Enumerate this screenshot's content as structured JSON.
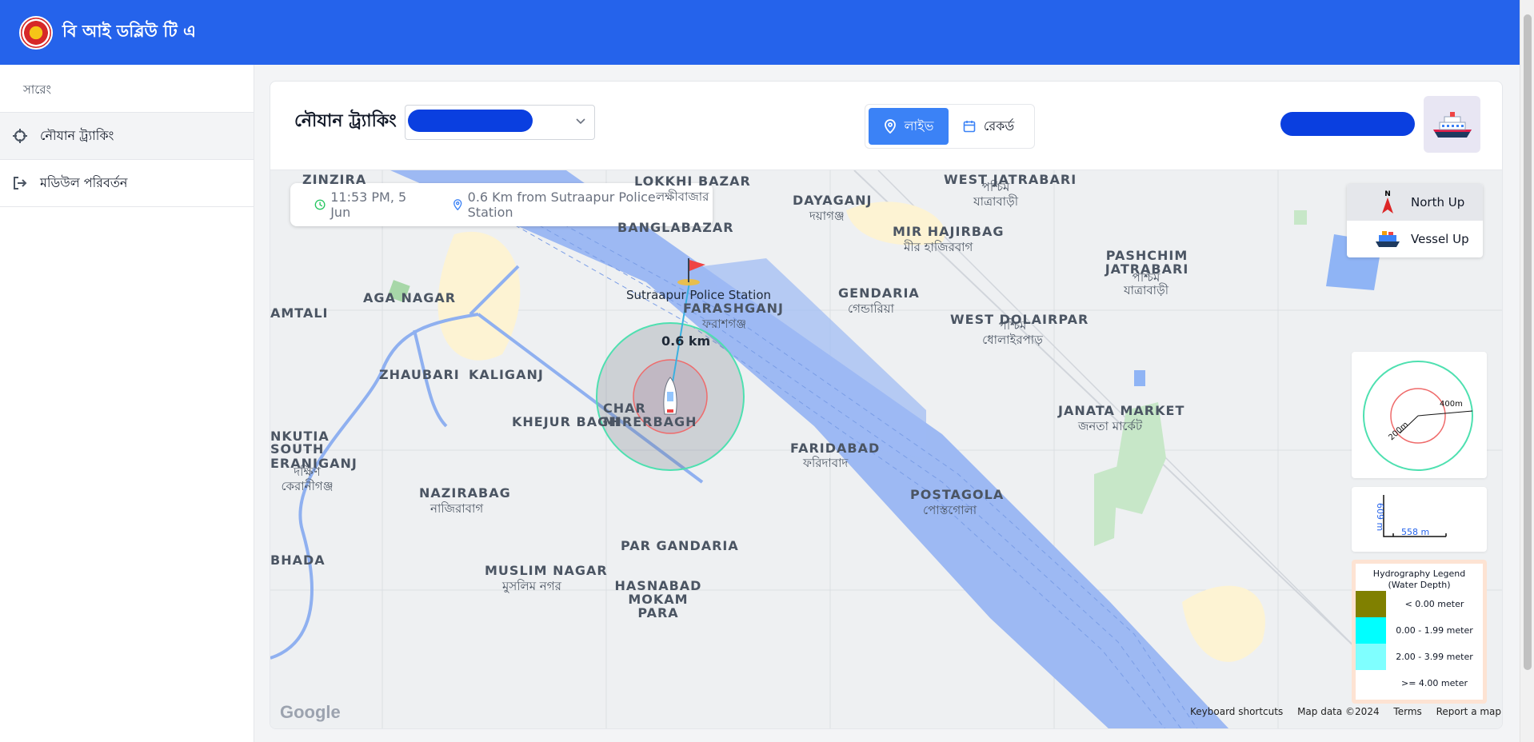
{
  "app": {
    "title": "বি আই ডব্লিউ টি এ",
    "logo": "biwta-logo"
  },
  "sidebar": {
    "heading": "সারেং",
    "items": [
      {
        "label": "নৌযান ট্র্যাকিং",
        "icon": "crosshair-icon"
      },
      {
        "label": "মডিউল পরিবর্তন",
        "icon": "logout-icon"
      }
    ]
  },
  "header": {
    "title": "নৌযান ট্র্যাকিং",
    "select_value": "",
    "live_label": "লাইভ",
    "record_label": "রেকর্ড",
    "user_name": ""
  },
  "info": {
    "time": "11:53 PM, 5 Jun",
    "distance_text": "0.6 Km from Sutraapur Police Station"
  },
  "orientation": {
    "north": "North Up",
    "vessel": "Vessel Up",
    "north_letter": "N"
  },
  "marker": {
    "station": "Sutraapur Police Station",
    "distance": "0.6 km"
  },
  "range": {
    "inner": "200m",
    "outer": "400m"
  },
  "scale": {
    "vertical": "609 m",
    "horizontal": "558 m"
  },
  "legend": {
    "title": "Hydrography Legend\n(Water Depth)",
    "rows": [
      {
        "label": "< 0.00 meter",
        "color": "#808000"
      },
      {
        "label": "0.00 - 1.99 meter",
        "color": "#00ffff"
      },
      {
        "label": "2.00 - 3.99 meter",
        "color": "#7fffff"
      },
      {
        "label": ">= 4.00 meter",
        "color": "#ffffff"
      }
    ]
  },
  "map": {
    "places": [
      {
        "en": "ZINZIRA",
        "bn": ""
      },
      {
        "en": "LOKKHI BAZAR",
        "bn": "লক্ষীবাজার"
      },
      {
        "en": "DAYAGANJ",
        "bn": "দয়াগঞ্জ"
      },
      {
        "en": "WEST JATRABARI",
        "bn": "পশ্চিম যাত্রাবাড়ী"
      },
      {
        "en": "BANGLABAZAR",
        "bn": ""
      },
      {
        "en": "MIR HAJIRBAG",
        "bn": "মীর হাজিরবাগ"
      },
      {
        "en": "PASHCHIM JATRABARI",
        "bn": "পশ্চিম যাত্রাবাড়ী"
      },
      {
        "en": "AGA NAGAR",
        "bn": ""
      },
      {
        "en": "FARASHGANJ",
        "bn": "ফরাশগঞ্জ"
      },
      {
        "en": "GENDARIA",
        "bn": "গেন্ডারিয়া"
      },
      {
        "en": "AMTALI",
        "bn": ""
      },
      {
        "en": "WEST DOLAIRPAR",
        "bn": "পশ্চিম ধোলাইরপাড়"
      },
      {
        "en": "ZHAUBARI",
        "bn": ""
      },
      {
        "en": "KALIGANJ",
        "bn": ""
      },
      {
        "en": "CHAR MIRERBAGH",
        "bn": ""
      },
      {
        "en": "KHEJUR BAGH",
        "bn": ""
      },
      {
        "en": "JANATA MARKET",
        "bn": "জনতা মার্কেট"
      },
      {
        "en": "NKUTIA",
        "bn": ""
      },
      {
        "en": "SOUTH ERANIGANJ",
        "bn": "দক্ষিণ কেরানীগঞ্জ"
      },
      {
        "en": "FARIDABAD",
        "bn": "ফরিদাবাদ"
      },
      {
        "en": "NAZIRABAG",
        "bn": "নাজিরাবাগ"
      },
      {
        "en": "POSTAGOLA",
        "bn": "পোস্তগোলা"
      },
      {
        "en": "PAR GANDARIA",
        "bn": ""
      },
      {
        "en": "BHADA",
        "bn": ""
      },
      {
        "en": "MUSLIM NAGAR",
        "bn": "মুসলিম নগর"
      },
      {
        "en": "HASNABAD MOKAM PARA",
        "bn": ""
      }
    ],
    "footer": {
      "keyboard": "Keyboard shortcuts",
      "data": "Map data ©2024",
      "terms": "Terms",
      "report": "Report a map error",
      "google": "Google"
    }
  }
}
